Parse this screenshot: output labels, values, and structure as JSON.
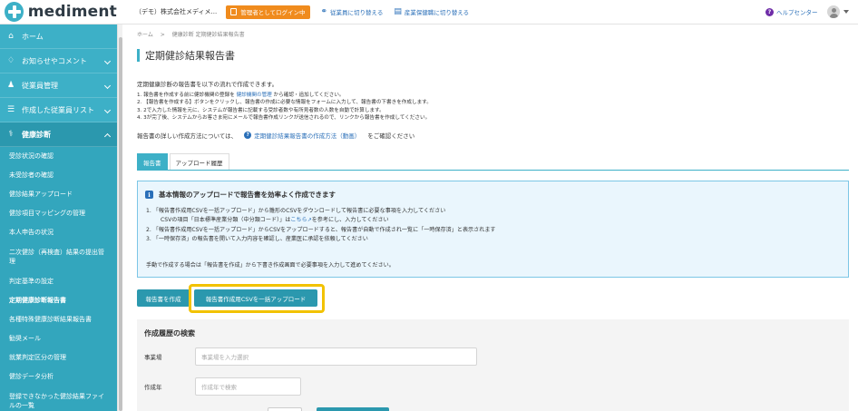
{
  "header": {
    "logo_text": "mediment",
    "company": "（デモ）株式会社メディメ...",
    "admin_badge": "管理者としてログイン中",
    "switch_employee": "従業員に切り替える",
    "switch_occupational": "産業保健職に切り替える",
    "help": "ヘルプセンター"
  },
  "sidebar": {
    "items": [
      {
        "label": "ホーム",
        "icon": "home-icon"
      },
      {
        "label": "お知らせやコメント",
        "icon": "bell-icon"
      },
      {
        "label": "従業員管理",
        "icon": "users-icon"
      },
      {
        "label": "作成した従業員リスト",
        "icon": "list-users-icon"
      },
      {
        "label": "健康診断",
        "icon": "stethoscope-icon"
      }
    ],
    "sub_items": [
      {
        "label": "受診状況の確認"
      },
      {
        "label": "未受診者の確認"
      },
      {
        "label": "健診結果アップロード"
      },
      {
        "label": "健診項目マッピングの管理"
      },
      {
        "label": "本人申告の状況"
      },
      {
        "label": "二次健診（再検査）結果の提出管理"
      },
      {
        "label": "判定基準の設定"
      },
      {
        "label": "定期健康診断報告書"
      },
      {
        "label": "各種特殊健康診断結果報告書"
      },
      {
        "label": "勧奨メール"
      },
      {
        "label": "就業判定区分の管理"
      },
      {
        "label": "健診データ分析"
      },
      {
        "label": "登録できなかった健診結果ファイルの一覧"
      }
    ]
  },
  "breadcrumb": {
    "home": "ホーム",
    "sep": ">",
    "current": "健康診断 定期健診結果報告書"
  },
  "page_title": "定期健診結果報告書",
  "intro": "定期健康診断の報告書を以下の流れで作成できます。",
  "steps": {
    "s1_pre": "1. 報告書を作成する前に健診機関の登録を",
    "s1_link": "健診機関の管理",
    "s1_post": "から確認・追加してください。",
    "s2": "2. 【報告書を作成する】ボタンをクリックし、報告書の作成に必要な情報をフォームに入力して、報告書の下書きを作成します。",
    "s3": "3. 2で入力した情報を元に、システムが報告書に記載する受診者数や有所見者数の人数を自動で計算します。",
    "s4": "4. 3が完了後、システムからお客さま宛にメールで報告書作成リンクが送信されるので、リンクから報告書を作成してください。"
  },
  "howto": {
    "pre": "報告書の詳しい作成方法については、",
    "link": "定期健診結果報告書の作成方法（動画）",
    "post": "をご確認ください"
  },
  "tabs": [
    {
      "label": "報告書"
    },
    {
      "label": "アップロード履歴"
    }
  ],
  "info": {
    "title": "基本情報のアップロードで報告書を効率よく作成できます",
    "l1": "1. 「報告書作成用CSVを一括アップロード」から雛形のCSVをダウンロードして報告書に必要な事項を入力してください",
    "l1b_pre": "CSVの項目「日本標準産業分類（中分類コード）」は",
    "l1b_link": "こちら",
    "l1b_post": "を参考にし、入力してください",
    "l2": "2. 「報告書作成用CSVを一括アップロード」からCSVをアップロードすると、報告書が自動で作成され一覧に「一時保存済」と表示されます",
    "l3": "3. 「一時保存済」の報告書を開いて入力内容を確認し、産業医に承認を依頼してください",
    "foot": "手動で作成する場合は「報告書を作成」から下書き作成画面で必要事項を入力して進めてください。"
  },
  "buttons": {
    "create": "報告書を作成",
    "bulk_upload": "報告書作成用CSVを一括アップロード"
  },
  "search": {
    "title": "作成履歴の検索",
    "site_label": "事業場",
    "site_placeholder": "事業場を入力選択",
    "year_label": "作成年",
    "year_placeholder": "作成年で検索"
  },
  "colors": {
    "brand": "#3db0c7",
    "accent": "#f08b1d",
    "highlight": "#f2c200",
    "link": "#2a6fb8"
  }
}
